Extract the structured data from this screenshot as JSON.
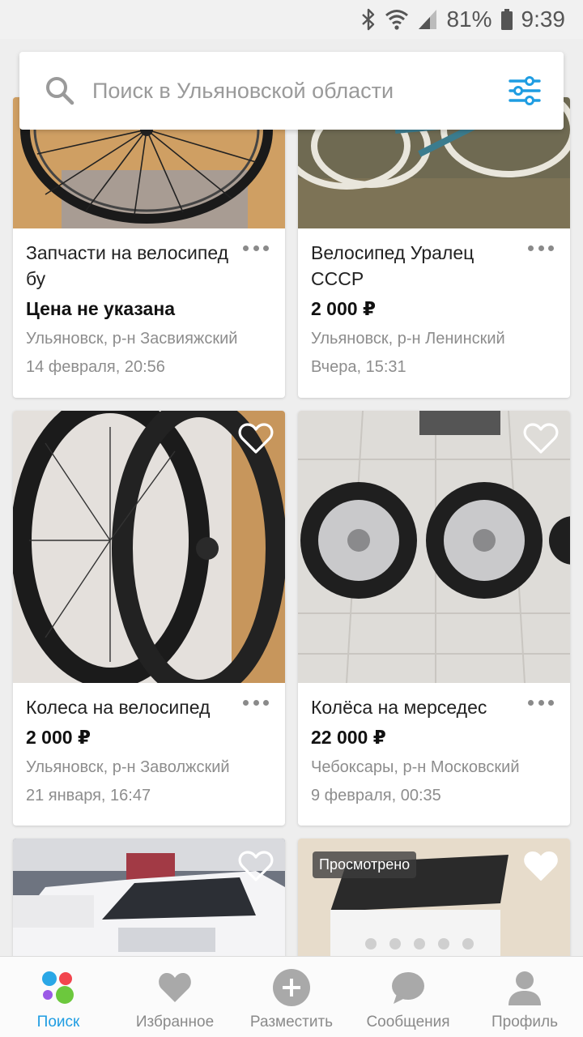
{
  "status_bar": {
    "battery": "81%",
    "time": "9:39"
  },
  "search": {
    "placeholder": "Поиск в Ульяновской области"
  },
  "listings": [
    {
      "title": "Запчасти на велосипед бу",
      "price": "Цена не указана",
      "location": "Ульяновск, р-н Засвияжский",
      "date": "14 февраля, 20:56"
    },
    {
      "title": "Велосипед Уралец СССР",
      "price": "2 000 ₽",
      "location": "Ульяновск, р-н Ленинский",
      "date": "Вчера, 15:31"
    },
    {
      "title": "Колеса на велосипед",
      "price": "2 000 ₽",
      "location": "Ульяновск, р-н Заволжский",
      "date": "21 января, 16:47"
    },
    {
      "title": "Колёса на мерседес",
      "price": "22 000 ₽",
      "location": "Чебоксары, р-н Московский",
      "date": "9 февраля, 00:35"
    },
    {
      "title": "",
      "price": "",
      "location": "",
      "date": ""
    },
    {
      "title": "",
      "price": "",
      "location": "",
      "date": "",
      "badge": "Просмотрено"
    }
  ],
  "bottom_nav": [
    {
      "label": "Поиск",
      "icon": "search-dots-icon",
      "active": true
    },
    {
      "label": "Избранное",
      "icon": "heart-icon"
    },
    {
      "label": "Разместить",
      "icon": "plus-circle-icon"
    },
    {
      "label": "Сообщения",
      "icon": "chat-bubble-icon"
    },
    {
      "label": "Профиль",
      "icon": "user-icon"
    }
  ],
  "colors": {
    "accent": "#1f9de2",
    "background": "#eeeeee",
    "card": "#ffffff"
  }
}
